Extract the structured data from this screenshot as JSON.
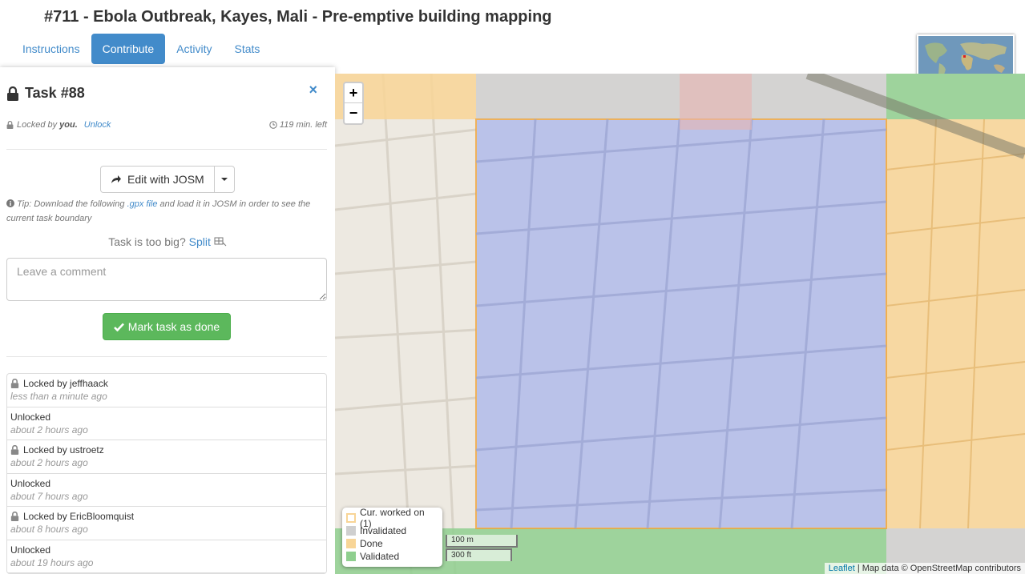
{
  "header": {
    "title": "#711 - Ebola Outbreak, Kayes, Mali - Pre-emptive building mapping"
  },
  "tabs": [
    {
      "label": "Instructions",
      "active": false
    },
    {
      "label": "Contribute",
      "active": true
    },
    {
      "label": "Activity",
      "active": false
    },
    {
      "label": "Stats",
      "active": false
    }
  ],
  "task": {
    "title": "Task #88",
    "close_symbol": "×",
    "locked_prefix": "Locked by",
    "locked_user": "you.",
    "unlock_label": "Unlock",
    "time_left": "119 min. left",
    "josm_label": "Edit with JOSM",
    "tip_prefix": "Tip: Download the following",
    "tip_link": ".gpx file",
    "tip_suffix": "and load it in JOSM in order to see the current task boundary",
    "split_prefix": "Task is too big?",
    "split_label": "Split",
    "comment_placeholder": "Leave a comment",
    "done_label": "Mark task as done"
  },
  "history": [
    {
      "text": "Locked by jeffhaack",
      "time": "less than a minute ago",
      "locked": true
    },
    {
      "text": "Unlocked",
      "time": "about 2 hours ago",
      "locked": false
    },
    {
      "text": "Locked by ustroetz",
      "time": "about 2 hours ago",
      "locked": true
    },
    {
      "text": "Unlocked",
      "time": "about 7 hours ago",
      "locked": false
    },
    {
      "text": "Locked by EricBloomquist",
      "time": "about 8 hours ago",
      "locked": true
    },
    {
      "text": "Unlocked",
      "time": "about 19 hours ago",
      "locked": false
    }
  ],
  "map": {
    "zoom_in": "+",
    "zoom_out": "−",
    "legend": [
      {
        "label": "Cur. worked on (1)",
        "color": "#ffffff",
        "border": "#f0ad4e"
      },
      {
        "label": "Invalidated",
        "color": "#cfcfcf",
        "border": "#cfcfcf"
      },
      {
        "label": "Done",
        "color": "#f8d597",
        "border": "#f8d597"
      },
      {
        "label": "Validated",
        "color": "#8fcf8f",
        "border": "#8fcf8f"
      }
    ],
    "scale_metric": "100 m",
    "scale_imperial": "300 ft",
    "attribution_link": "Leaflet",
    "attribution_text": "| Map data © OpenStreetMap contributors"
  },
  "colors": {
    "accent": "#428bca",
    "success": "#5cb85c",
    "current_task_fill": "#a9b5ec",
    "task_border": "#f0a030"
  }
}
